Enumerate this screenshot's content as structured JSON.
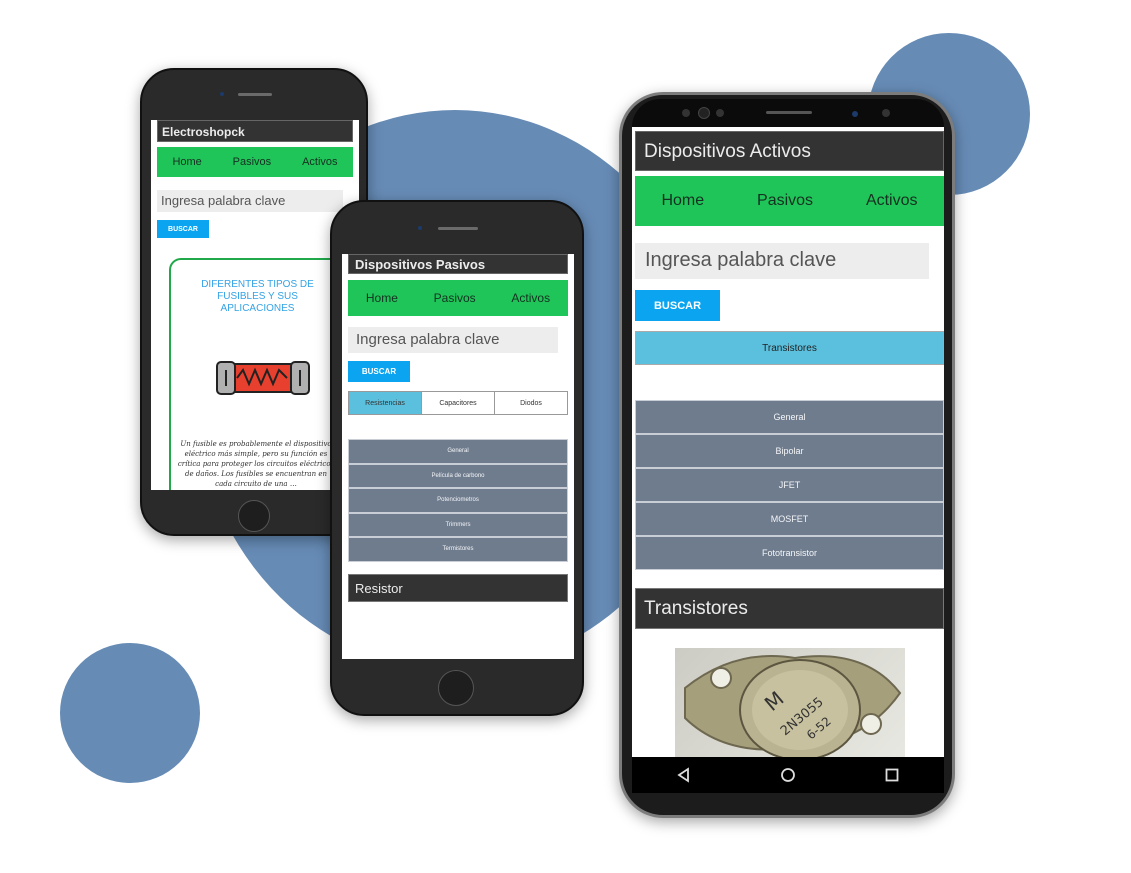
{
  "colors": {
    "blob": "#668bb5",
    "nav_green": "#20c55a",
    "buscar_blue": "#0aa4f0",
    "active_tab": "#5bc0de",
    "menu_gray": "#6f7c8e"
  },
  "phone_left": {
    "title": "Electroshopck",
    "nav": [
      "Home",
      "Pasivos",
      "Activos"
    ],
    "search_placeholder": "Ingresa palabra clave",
    "buscar": "BUSCAR",
    "card_title": "DIFERENTES TIPOS DE FUSIBLES Y SUS APLICACIONES",
    "card_text": "Un fusible es probablemente el dispositivo eléctrico más simple, pero su función es crítica para proteger los circuitos eléctricos de daños. Los fusibles se encuentran en cada circuito de una …",
    "card_image_icon": "fuse-icon"
  },
  "phone_middle": {
    "title": "Dispositivos Pasivos",
    "nav": [
      "Home",
      "Pasivos",
      "Activos"
    ],
    "search_placeholder": "Ingresa palabra clave",
    "buscar": "BUSCAR",
    "tabs": [
      "Resistencias",
      "Capacitores",
      "Diodos"
    ],
    "active_tab": "Resistencias",
    "menu": [
      "General",
      "Película de carbono",
      "Potenciometros",
      "Trimmers",
      "Termistores"
    ],
    "section_title": "Resistor"
  },
  "phone_right": {
    "title": "Dispositivos Activos",
    "nav": [
      "Home",
      "Pasivos",
      "Activos"
    ],
    "search_placeholder": "Ingresa palabra clave",
    "buscar": "BUSCAR",
    "category": "Transistores",
    "menu": [
      "General",
      "Bipolar",
      "JFET",
      "MOSFET",
      "Fototransistor"
    ],
    "section_title": "Transistores",
    "photo_label_line1": "2N3055",
    "photo_label_line2": "6-52",
    "photo_logo": "M",
    "softkeys": [
      "back-icon",
      "home-icon",
      "recents-icon"
    ]
  }
}
